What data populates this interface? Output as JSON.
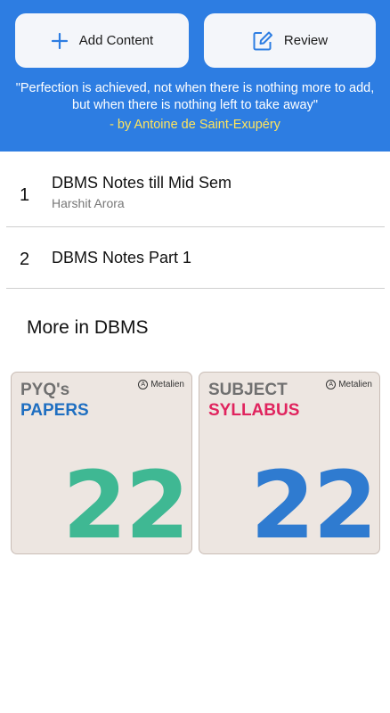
{
  "theme": {
    "accent": "#2d7de2",
    "quote_author_color": "#ffe45c"
  },
  "header": {
    "add_button": {
      "label": "Add Content",
      "icon": "plus-icon"
    },
    "review_button": {
      "label": "Review",
      "icon": "edit-icon"
    },
    "quote": "\"Perfection is achieved, not when there is nothing more to add, but when there is nothing left to take away\"",
    "quote_author": "- by Antoine de Saint-Exupéry"
  },
  "notes": [
    {
      "number": "1",
      "title": "DBMS Notes till Mid Sem",
      "author": "Harshit Arora"
    },
    {
      "number": "2",
      "title": "DBMS Notes Part 1"
    }
  ],
  "more_section": {
    "title": "More in DBMS",
    "cards": [
      {
        "line1": "PYQ's",
        "line2": "PAPERS",
        "brand": "Metalien",
        "brand_mark": "A",
        "big_number": "22"
      },
      {
        "line1": "SUBJECT",
        "line2": "SYLLABUS",
        "brand": "Metalien",
        "brand_mark": "A",
        "big_number": "22"
      }
    ]
  }
}
